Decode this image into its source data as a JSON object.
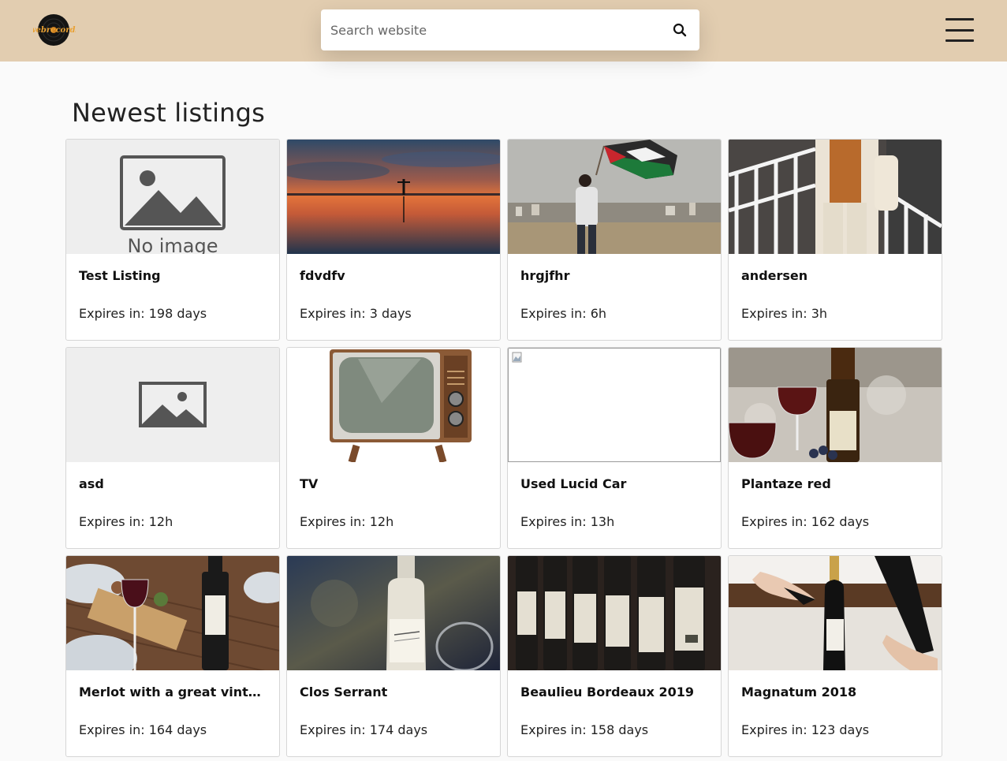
{
  "header": {
    "logo_text": "webrecords",
    "search_placeholder": "Search website"
  },
  "main": {
    "title": "Newest listings",
    "listings": [
      {
        "title": "Test Listing",
        "expires": "Expires in: 198 days",
        "image": "no-image-placeholder",
        "placeholder_text": "No image"
      },
      {
        "title": "fdvdfv",
        "expires": "Expires in: 3 days",
        "image": "sunset-lake-photo"
      },
      {
        "title": "hrgjfhr",
        "expires": "Expires in: 6h",
        "image": "flag-city-photo"
      },
      {
        "title": "andersen",
        "expires": "Expires in: 3h",
        "image": "fashion-photo"
      },
      {
        "title": "asd",
        "expires": "Expires in: 12h",
        "image": "generic-image-placeholder"
      },
      {
        "title": "TV",
        "expires": "Expires in: 12h",
        "image": "retro-tv-photo"
      },
      {
        "title": "Used Lucid Car",
        "expires": "Expires in: 13h",
        "image": "broken-image-icon"
      },
      {
        "title": "Plantaze red",
        "expires": "Expires in: 162 days",
        "image": "red-wine-photo"
      },
      {
        "title": "Merlot with a great vinta...",
        "expires": "Expires in: 164 days",
        "image": "merlot-dinner-photo"
      },
      {
        "title": "Clos Serrant",
        "expires": "Expires in: 174 days",
        "image": "white-wine-bottle-photo"
      },
      {
        "title": "Beaulieu Bordeaux 2019",
        "expires": "Expires in: 158 days",
        "image": "bordeaux-bottles-photo"
      },
      {
        "title": "Magnatum 2018",
        "expires": "Expires in: 123 days",
        "image": "champagne-photo"
      }
    ]
  },
  "colors": {
    "header_bg": "#e2cdb0",
    "page_bg": "#fafafa",
    "card_border": "#d6d6d6"
  }
}
